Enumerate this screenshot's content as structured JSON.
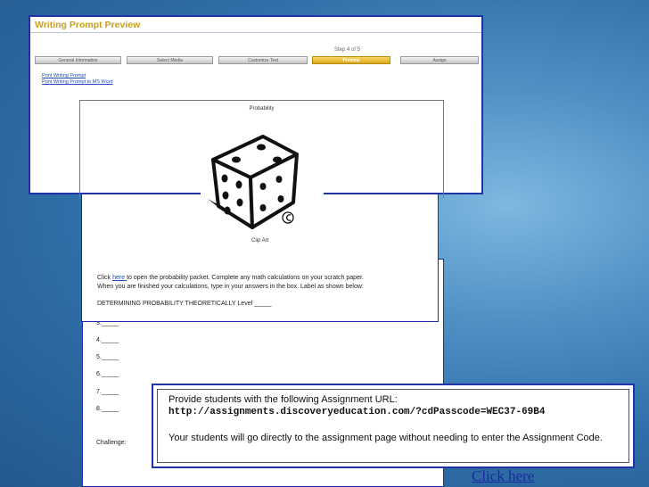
{
  "preview": {
    "title": "Writing Prompt Preview",
    "step_text": "Step 4 of 5",
    "steps": [
      "General Information",
      "Select Media",
      "Customize Text",
      "Preview",
      "Assign"
    ],
    "active_step": "Preview",
    "links": [
      "Print Writing Prompt",
      "Print Writing Prompt to MS Word"
    ],
    "doc_title": "Probability"
  },
  "lesson": {
    "clip_label": "Clip Art",
    "para_prefix": "Click ",
    "para_link": "here ",
    "para_line1_rest": "to open the probability packet. Complete any math calculations on your scratch paper.",
    "para_line2": "When you are finished your calculations, type in your answers in the box. Label as shown below:",
    "heading": "DETERMINING PROBABILITY THEORETICALLY   Level _____"
  },
  "answers": {
    "items": [
      "3._____",
      "4._____",
      "5._____",
      "6._____",
      "7._____",
      "8._____"
    ],
    "challenge": "Challenge:"
  },
  "assignment": {
    "line1": "Provide students with the following Assignment URL:",
    "url": "http://assignments.discoveryeducation.com/?cdPasscode=WEC37-69B4",
    "line3": "Your students will go directly to the assignment page without needing to enter the Assignment Code."
  },
  "click_here": "Click here"
}
